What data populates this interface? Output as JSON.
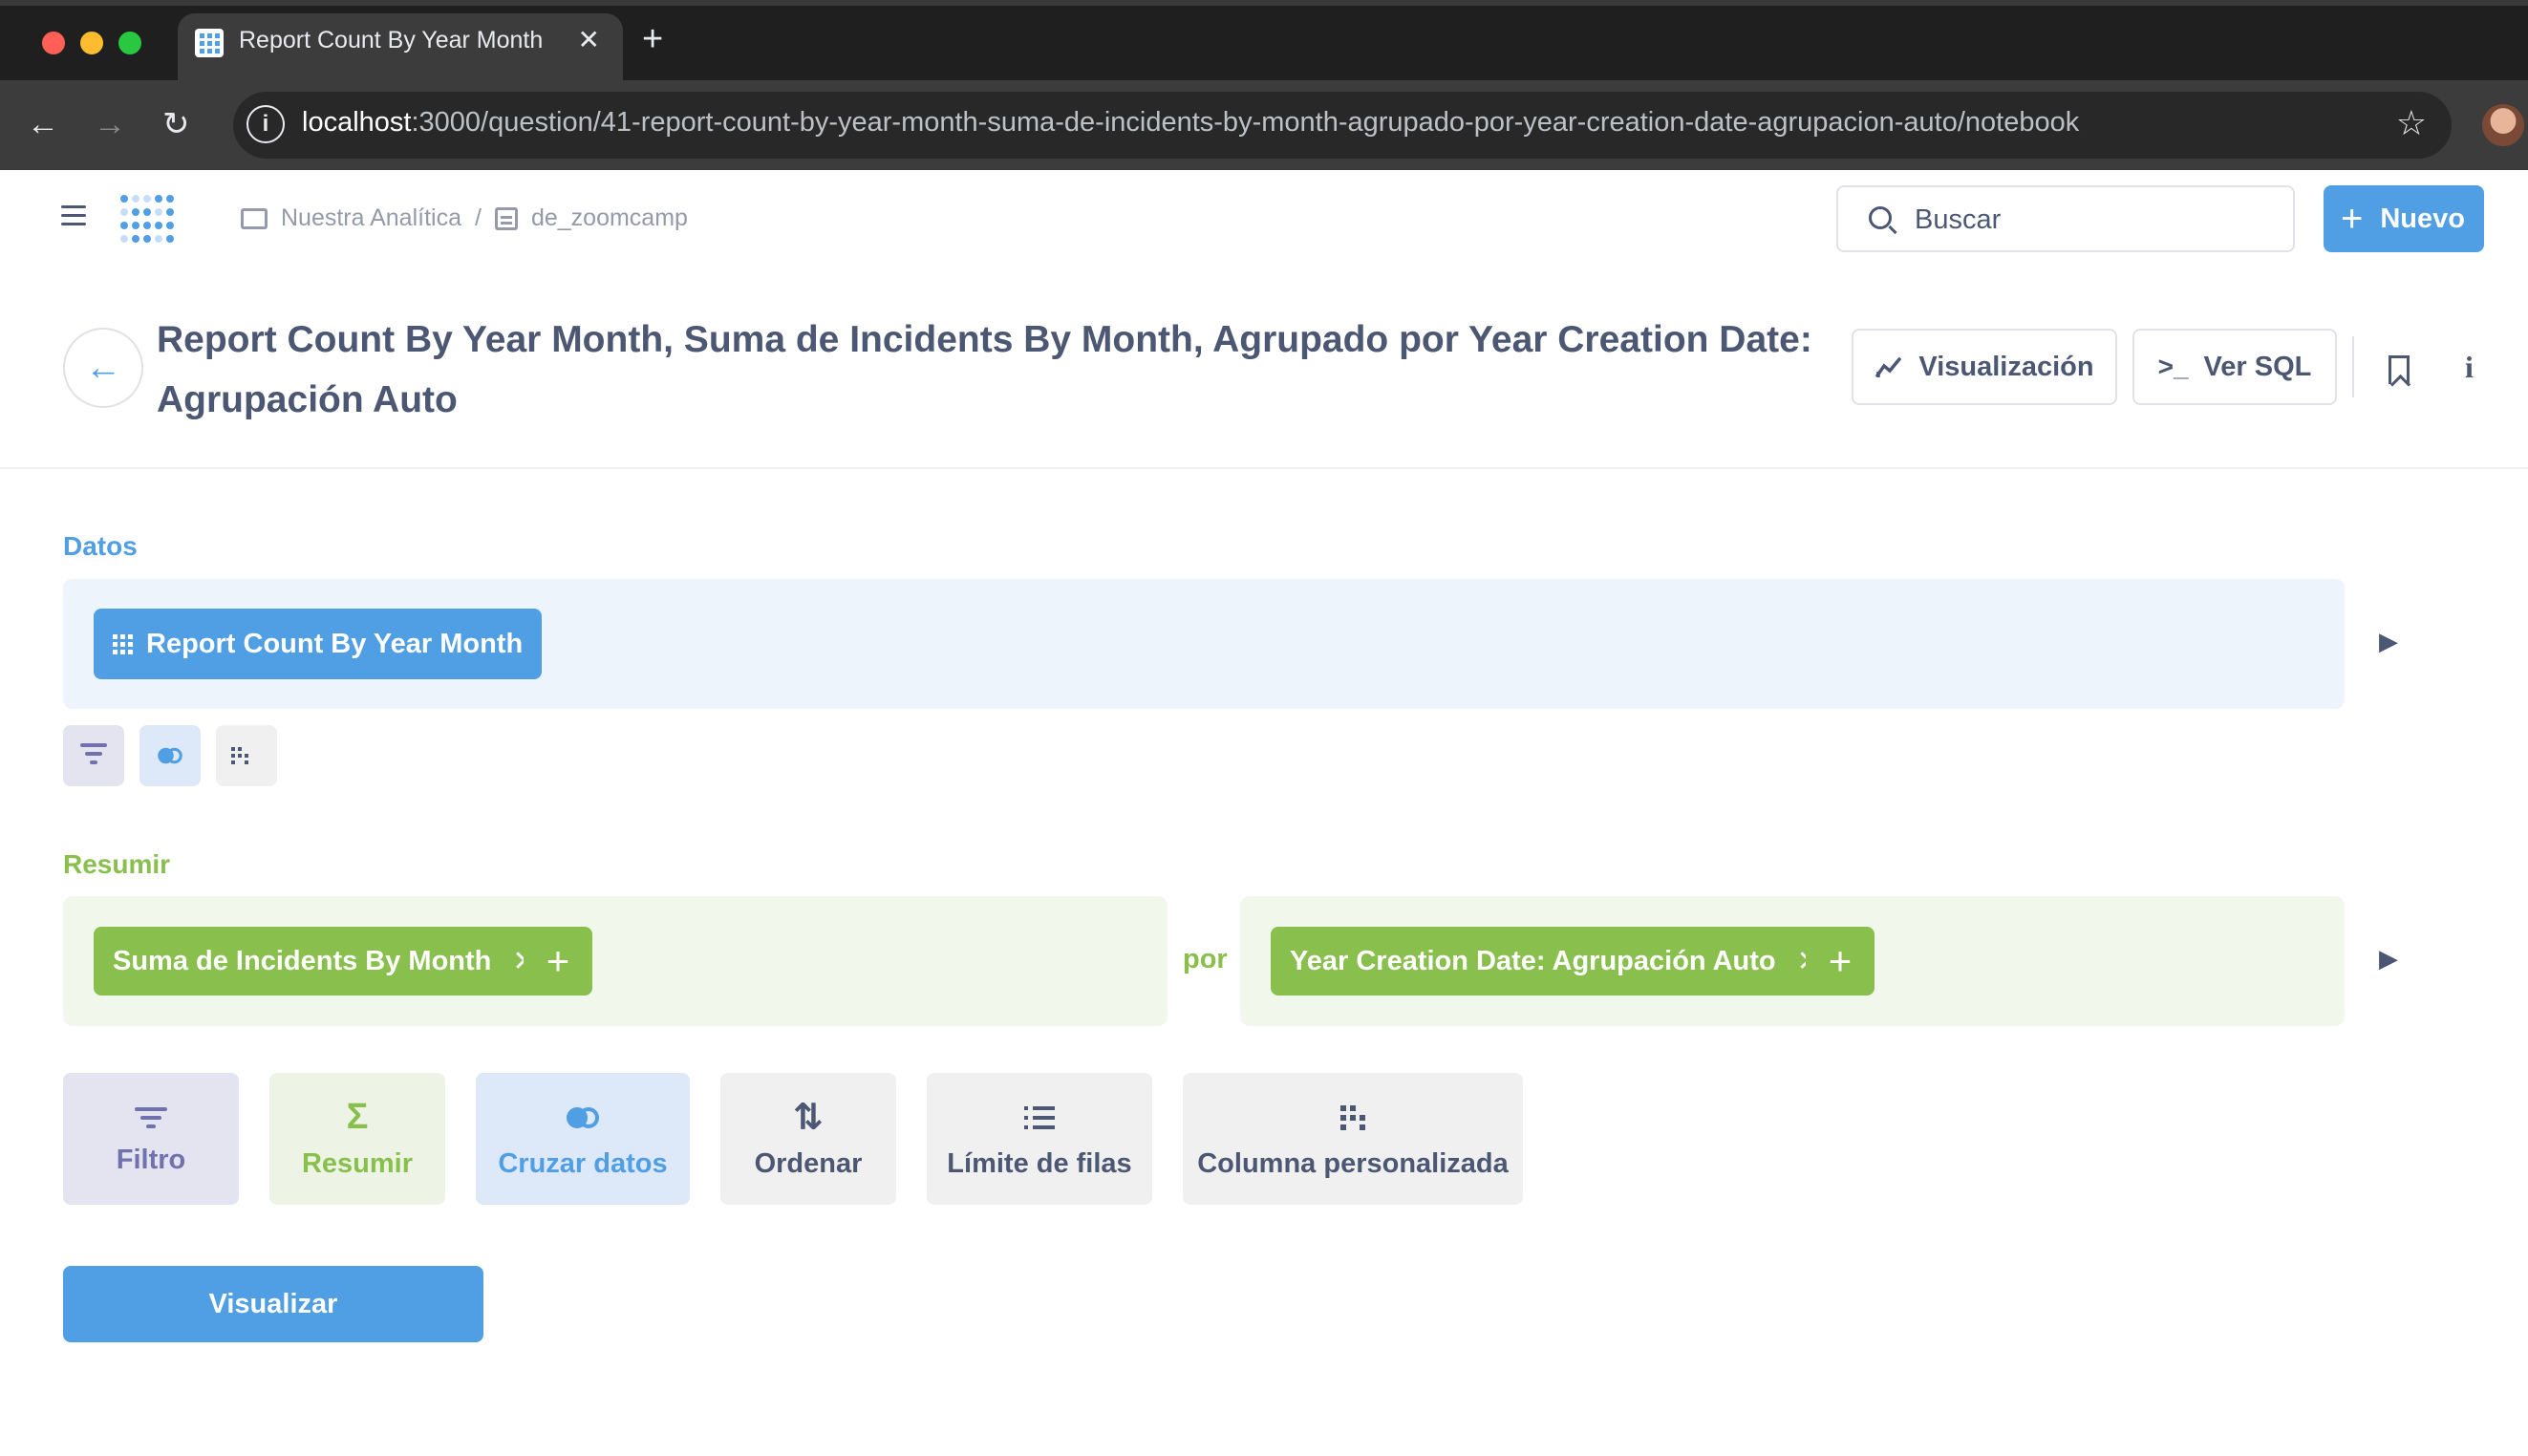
{
  "browser": {
    "tab_title": "Report Count By Year Month,",
    "url_host": "localhost",
    "url_path": ":3000/question/41-report-count-by-year-month-suma-de-incidents-by-month-agrupado-por-year-creation-date-agrupacion-auto/notebook",
    "window_controls": {
      "close": "#ff5f57",
      "minimize": "#febc2e",
      "maximize": "#28c840"
    }
  },
  "nav": {
    "breadcrumb": [
      "Nuestra Analítica",
      "de_zoomcamp"
    ],
    "breadcrumb_sep": "/",
    "search_placeholder": "Buscar",
    "new_label": "Nuevo"
  },
  "question": {
    "title": "Report Count By Year Month, Suma de Incidents By Month, Agrupado por Year Creation Date: Agrupación Auto",
    "visualization_label": "Visualización",
    "sql_label": "Ver SQL"
  },
  "notebook": {
    "data_label": "Datos",
    "data_source": "Report Count By Year Month",
    "summarize_label": "Resumir",
    "metric": "Suma de Incidents By Month",
    "by_label": "por",
    "breakout": "Year Creation Date: Agrupación Auto",
    "steps": {
      "filter": "Filtro",
      "summarize": "Resumir",
      "join": "Cruzar datos",
      "sort": "Ordenar",
      "limit": "Límite de filas",
      "custom_column": "Columna personalizada"
    },
    "visualize_label": "Visualizar"
  },
  "colors": {
    "brand": "#509ee3",
    "summarize": "#88bf4d",
    "filter": "#7172ad",
    "text": "#4c5773"
  }
}
